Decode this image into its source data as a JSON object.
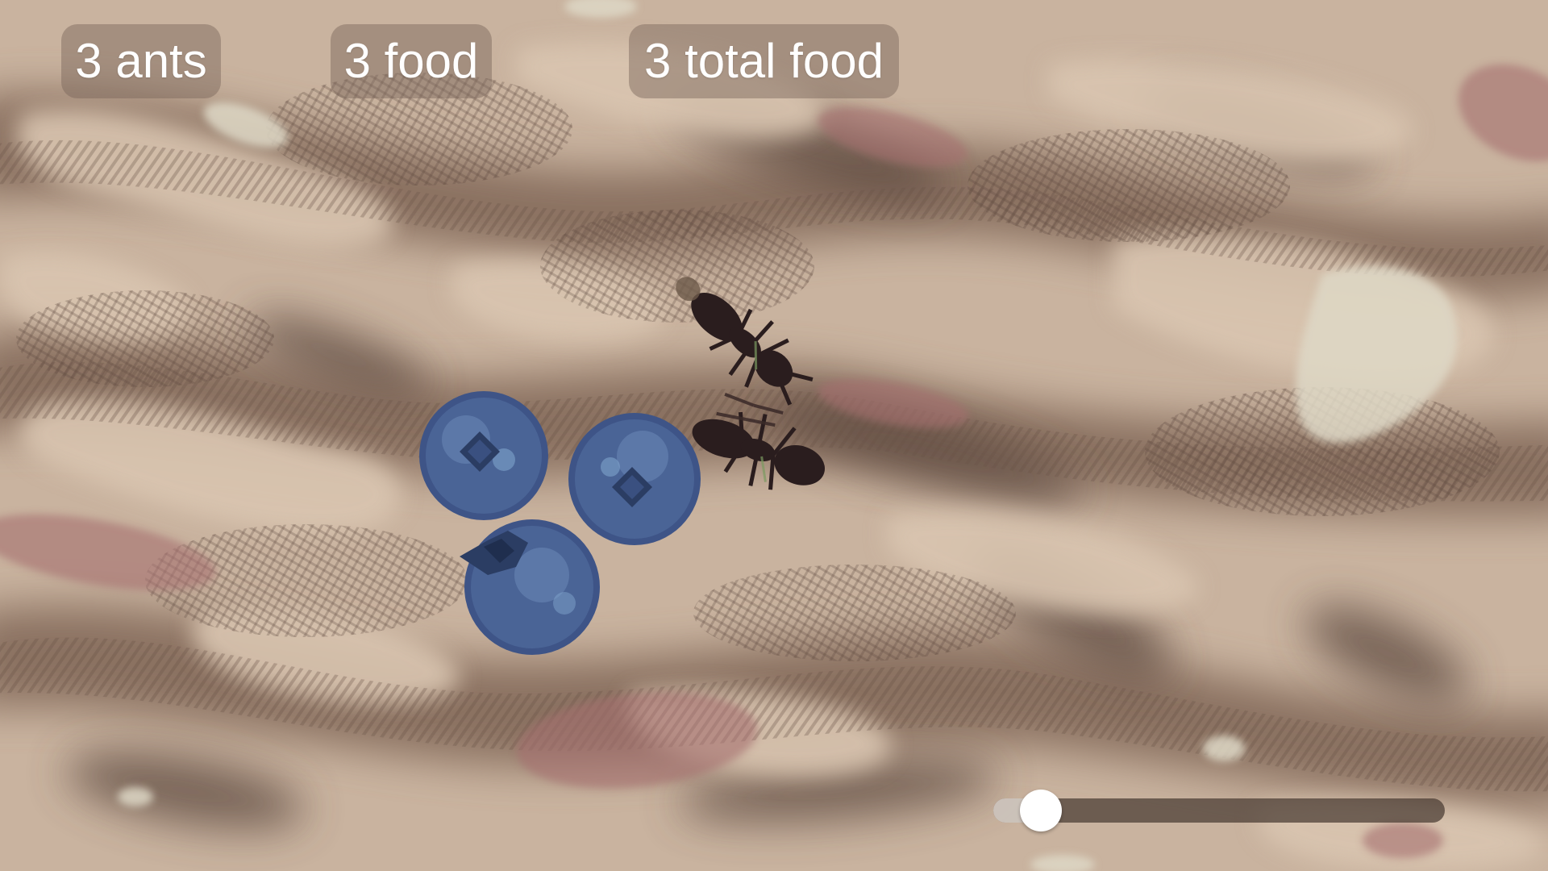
{
  "hud": {
    "ants_label": "3 ants",
    "food_label": "3 food",
    "total_food_label": "3 total food"
  },
  "speed_slider": {
    "value": 0.07
  },
  "colors": {
    "ground_light": "#d6c2ad",
    "ground_dark": "#6b5448",
    "puddle_pale": "#dcd6c4",
    "patch_pink": "#a56f70",
    "berry_blue": "#4a6496",
    "ant_dark": "#2a1d1e"
  },
  "icons": [
    "ant-sprite",
    "blueberry-sprite"
  ]
}
